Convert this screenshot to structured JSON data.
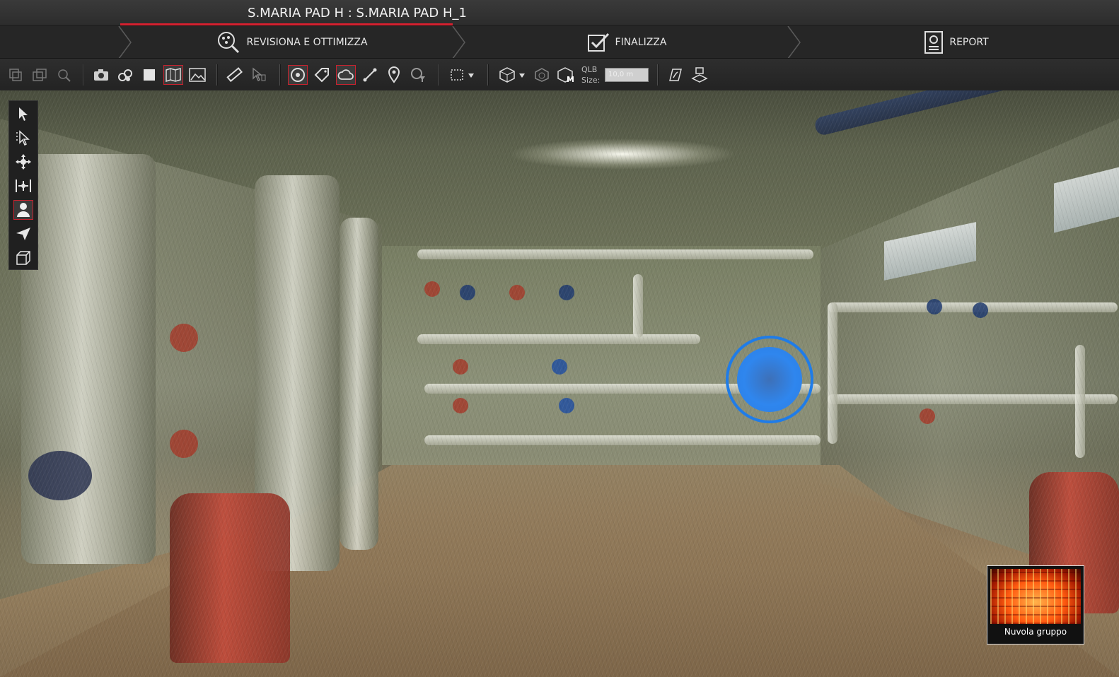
{
  "window": {
    "title": "S.MARIA PAD H : S.MARIA PAD H_1"
  },
  "steps": [
    {
      "label": "REVISIONA E OTTIMIZZA",
      "icon": "review-magnifier-icon",
      "active": true
    },
    {
      "label": "FINALIZZA",
      "icon": "checkbox-icon",
      "active": false
    },
    {
      "label": "REPORT",
      "icon": "report-icon",
      "active": false
    }
  ],
  "toolbar": {
    "qlb_label_line1": "QLB",
    "qlb_label_line2": "Size:",
    "qlb_value": "10,0 m"
  },
  "thumbnail": {
    "label": "Nuvola gruppo"
  },
  "colors": {
    "accent": "#d6202f",
    "target": "#1f7ce8",
    "toolbar_bg": "#262626"
  }
}
